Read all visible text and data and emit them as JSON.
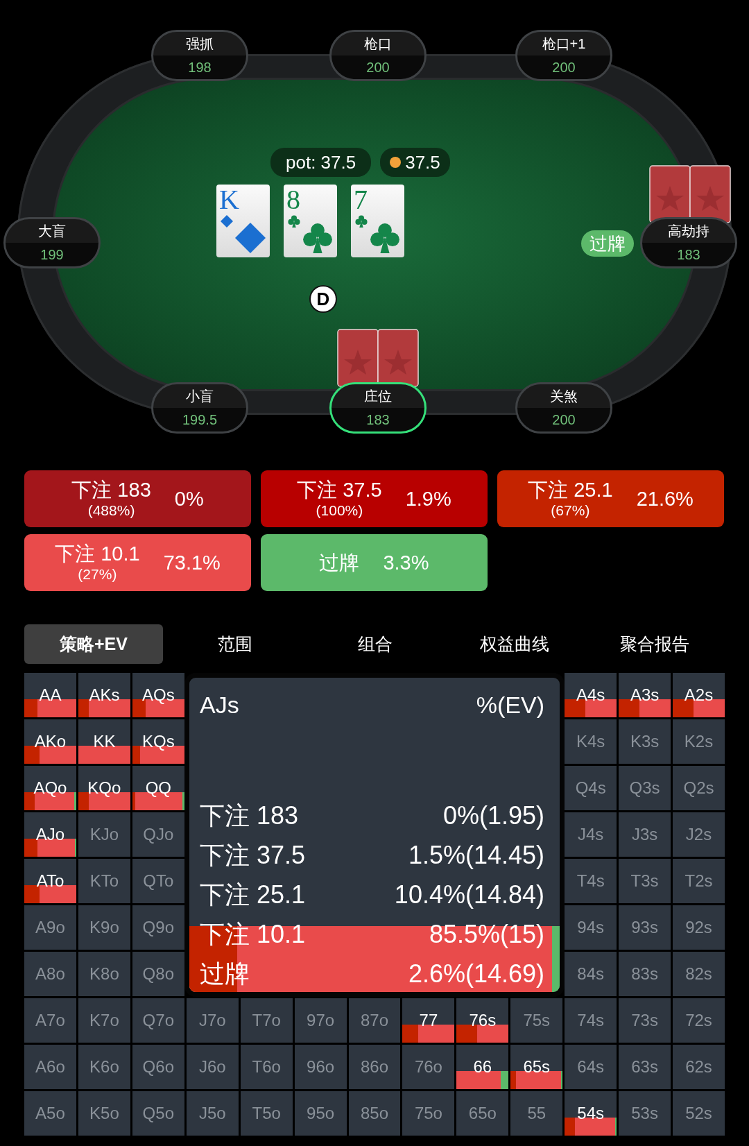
{
  "table": {
    "pot": "pot: 37.5",
    "chips": "37.5",
    "board": [
      {
        "rank": "K",
        "kind": "diamond"
      },
      {
        "rank": "8",
        "kind": "club"
      },
      {
        "rank": "7",
        "kind": "club"
      }
    ],
    "dealer": "D",
    "seats": [
      {
        "name": "强抓",
        "stack": "198",
        "active": false,
        "has_cards": false
      },
      {
        "name": "枪口",
        "stack": "200",
        "active": false,
        "has_cards": false
      },
      {
        "name": "枪口+1",
        "stack": "200",
        "active": false,
        "has_cards": false
      },
      {
        "name": "大盲",
        "stack": "199",
        "active": false,
        "has_cards": false
      },
      {
        "name": "高劫持",
        "stack": "183",
        "active": false,
        "has_cards": true,
        "action": "过牌"
      },
      {
        "name": "小盲",
        "stack": "199.5",
        "active": false,
        "has_cards": false
      },
      {
        "name": "庄位",
        "stack": "183",
        "active": true,
        "has_cards": true
      },
      {
        "name": "关煞",
        "stack": "200",
        "active": false,
        "has_cards": false
      }
    ]
  },
  "actions": [
    {
      "label": "下注 183",
      "sub": "(488%)",
      "freq": "0%",
      "color": "#a3161b"
    },
    {
      "label": "下注 37.5",
      "sub": "(100%)",
      "freq": "1.9%",
      "color": "#b80000"
    },
    {
      "label": "下注 25.1",
      "sub": "(67%)",
      "freq": "21.6%",
      "color": "#c42300"
    },
    {
      "label": "下注 10.1",
      "sub": "(27%)",
      "freq": "73.1%",
      "color": "#e94b4b"
    },
    {
      "label": "过牌",
      "freq": "3.3%",
      "color": "#5cb96a"
    }
  ],
  "tabs": [
    {
      "label": "策略+EV",
      "selected": true
    },
    {
      "label": "范围",
      "selected": false
    },
    {
      "label": "组合",
      "selected": false
    },
    {
      "label": "权益曲线",
      "selected": false
    },
    {
      "label": "聚合报告",
      "selected": false
    }
  ],
  "grid": {
    "rows": [
      [
        {
          "label": "AA",
          "in_range": true,
          "segments": [
            {
              "color": "#c42300",
              "level": 0.25
            },
            {
              "color": "#e94b4b",
              "level": 1
            }
          ]
        },
        {
          "label": "AKs",
          "in_range": true,
          "segments": [
            {
              "color": "#c42300",
              "level": 0.2
            },
            {
              "color": "#e94b4b",
              "level": 1
            }
          ]
        },
        {
          "label": "AQs",
          "in_range": true,
          "segments": [
            {
              "color": "#c42300",
              "level": 0.25
            },
            {
              "color": "#e94b4b",
              "level": 1
            }
          ]
        },
        null,
        null,
        null,
        null,
        null,
        null,
        null,
        {
          "label": "A4s",
          "in_range": true,
          "segments": [
            {
              "color": "#c42300",
              "level": 0.4
            },
            {
              "color": "#e94b4b",
              "level": 1
            }
          ]
        },
        {
          "label": "A3s",
          "in_range": true,
          "segments": [
            {
              "color": "#c42300",
              "level": 0.4
            },
            {
              "color": "#e94b4b",
              "level": 1
            }
          ]
        },
        {
          "label": "A2s",
          "in_range": true,
          "segments": [
            {
              "color": "#c42300",
              "level": 0.4
            },
            {
              "color": "#e94b4b",
              "level": 1
            }
          ]
        }
      ],
      [
        {
          "label": "AKo",
          "in_range": true,
          "segments": [
            {
              "color": "#c42300",
              "level": 0.3
            },
            {
              "color": "#e94b4b",
              "level": 1
            }
          ]
        },
        {
          "label": "KK",
          "in_range": true,
          "segments": [
            {
              "color": "#e94b4b",
              "level": 1
            }
          ]
        },
        {
          "label": "KQs",
          "in_range": true,
          "segments": [
            {
              "color": "#c42300",
              "level": 0.15
            },
            {
              "color": "#e94b4b",
              "level": 1
            }
          ]
        },
        null,
        null,
        null,
        null,
        null,
        null,
        null,
        {
          "label": "K4s",
          "in_range": false
        },
        {
          "label": "K3s",
          "in_range": false
        },
        {
          "label": "K2s",
          "in_range": false
        }
      ],
      [
        {
          "label": "AQo",
          "in_range": true,
          "segments": [
            {
              "color": "#c42300",
              "level": 0.2
            },
            {
              "color": "#e94b4b",
              "level": 0.96
            },
            {
              "color": "#5cb96a",
              "level": 1
            }
          ]
        },
        {
          "label": "KQo",
          "in_range": true,
          "segments": [
            {
              "color": "#c42300",
              "level": 0.2
            },
            {
              "color": "#e94b4b",
              "level": 1
            }
          ]
        },
        {
          "label": "QQ",
          "in_range": true,
          "segments": [
            {
              "color": "#c42300",
              "level": 0.05
            },
            {
              "color": "#e94b4b",
              "level": 0.96
            },
            {
              "color": "#5cb96a",
              "level": 1
            }
          ]
        },
        null,
        null,
        null,
        null,
        null,
        null,
        null,
        {
          "label": "Q4s",
          "in_range": false
        },
        {
          "label": "Q3s",
          "in_range": false
        },
        {
          "label": "Q2s",
          "in_range": false
        }
      ],
      [
        {
          "label": "AJo",
          "in_range": true,
          "segments": [
            {
              "color": "#c42300",
              "level": 0.25
            },
            {
              "color": "#e94b4b",
              "level": 0.97
            },
            {
              "color": "#5cb96a",
              "level": 1
            }
          ]
        },
        {
          "label": "KJo",
          "in_range": false
        },
        {
          "label": "QJo",
          "in_range": false
        },
        null,
        null,
        null,
        null,
        null,
        null,
        null,
        {
          "label": "J4s",
          "in_range": false
        },
        {
          "label": "J3s",
          "in_range": false
        },
        {
          "label": "J2s",
          "in_range": false
        }
      ],
      [
        {
          "label": "ATo",
          "in_range": true,
          "segments": [
            {
              "color": "#c42300",
              "level": 0.3
            },
            {
              "color": "#e94b4b",
              "level": 1
            }
          ]
        },
        {
          "label": "KTo",
          "in_range": false
        },
        {
          "label": "QTo",
          "in_range": false
        },
        null,
        null,
        null,
        null,
        null,
        null,
        null,
        {
          "label": "T4s",
          "in_range": false
        },
        {
          "label": "T3s",
          "in_range": false
        },
        {
          "label": "T2s",
          "in_range": false
        }
      ],
      [
        {
          "label": "A9o",
          "in_range": false
        },
        {
          "label": "K9o",
          "in_range": false
        },
        {
          "label": "Q9o",
          "in_range": false
        },
        null,
        null,
        null,
        null,
        null,
        null,
        null,
        {
          "label": "94s",
          "in_range": false
        },
        {
          "label": "93s",
          "in_range": false
        },
        {
          "label": "92s",
          "in_range": false
        }
      ],
      [
        {
          "label": "A8o",
          "in_range": false
        },
        {
          "label": "K8o",
          "in_range": false
        },
        {
          "label": "Q8o",
          "in_range": false
        },
        null,
        null,
        null,
        null,
        null,
        null,
        null,
        {
          "label": "84s",
          "in_range": false
        },
        {
          "label": "83s",
          "in_range": false
        },
        {
          "label": "82s",
          "in_range": false
        }
      ],
      [
        {
          "label": "A7o",
          "in_range": false
        },
        {
          "label": "K7o",
          "in_range": false
        },
        {
          "label": "Q7o",
          "in_range": false
        },
        {
          "label": "J7o",
          "in_range": false
        },
        {
          "label": "T7o",
          "in_range": false
        },
        {
          "label": "97o",
          "in_range": false
        },
        {
          "label": "87o",
          "in_range": false
        },
        {
          "label": "77",
          "in_range": true,
          "segments": [
            {
              "color": "#c42300",
              "level": 0.3
            },
            {
              "color": "#e94b4b",
              "level": 1
            }
          ]
        },
        {
          "label": "76s",
          "in_range": true,
          "segments": [
            {
              "color": "#c42300",
              "level": 0.4
            },
            {
              "color": "#e94b4b",
              "level": 1
            }
          ]
        },
        {
          "label": "75s",
          "in_range": false
        },
        {
          "label": "74s",
          "in_range": false
        },
        {
          "label": "73s",
          "in_range": false
        },
        {
          "label": "72s",
          "in_range": false
        }
      ],
      [
        {
          "label": "A6o",
          "in_range": false
        },
        {
          "label": "K6o",
          "in_range": false
        },
        {
          "label": "Q6o",
          "in_range": false
        },
        {
          "label": "J6o",
          "in_range": false
        },
        {
          "label": "T6o",
          "in_range": false
        },
        {
          "label": "96o",
          "in_range": false
        },
        {
          "label": "86o",
          "in_range": false
        },
        {
          "label": "76o",
          "in_range": false
        },
        {
          "label": "66",
          "in_range": true,
          "segments": [
            {
              "color": "#e94b4b",
              "level": 0.85
            },
            {
              "color": "#5cb96a",
              "level": 1
            }
          ]
        },
        {
          "label": "65s",
          "in_range": true,
          "segments": [
            {
              "color": "#c42300",
              "level": 0.1
            },
            {
              "color": "#e94b4b",
              "level": 0.97
            },
            {
              "color": "#5cb96a",
              "level": 1
            }
          ]
        },
        {
          "label": "64s",
          "in_range": false
        },
        {
          "label": "63s",
          "in_range": false
        },
        {
          "label": "62s",
          "in_range": false
        }
      ],
      [
        {
          "label": "A5o",
          "in_range": false
        },
        {
          "label": "K5o",
          "in_range": false
        },
        {
          "label": "Q5o",
          "in_range": false
        },
        {
          "label": "J5o",
          "in_range": false
        },
        {
          "label": "T5o",
          "in_range": false
        },
        {
          "label": "95o",
          "in_range": false
        },
        {
          "label": "85o",
          "in_range": false
        },
        {
          "label": "75o",
          "in_range": false
        },
        {
          "label": "65o",
          "in_range": false
        },
        {
          "label": "55",
          "in_range": false
        },
        {
          "label": "54s",
          "in_range": true,
          "segments": [
            {
              "color": "#c42300",
              "level": 0.2
            },
            {
              "color": "#e94b4b",
              "level": 0.97
            },
            {
              "color": "#5cb96a",
              "level": 1
            }
          ]
        },
        {
          "label": "53s",
          "in_range": false
        },
        {
          "label": "52s",
          "in_range": false
        }
      ]
    ],
    "tooltip": {
      "hand": "AJs",
      "header": "%(EV)",
      "rows": [
        {
          "label": "下注 183",
          "value": "0%(1.95)"
        },
        {
          "label": "下注 37.5",
          "value": "1.5%(14.45)"
        },
        {
          "label": "下注 25.1",
          "value": "10.4%(14.84)"
        },
        {
          "label": "下注 10.1",
          "value": "85.5%(15)"
        },
        {
          "label": "过牌",
          "value": "2.6%(14.69)"
        }
      ],
      "segments": [
        {
          "color": "#c42300",
          "level": 0.13
        },
        {
          "color": "#e94b4b",
          "level": 0.98
        },
        {
          "color": "#5cb96a",
          "level": 1
        }
      ]
    }
  }
}
